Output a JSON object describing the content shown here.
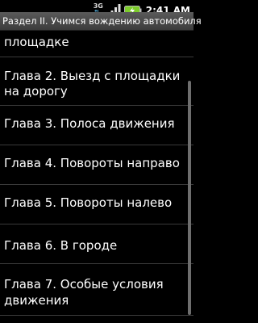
{
  "status_bar": {
    "network_label": "3G",
    "time": "2:41 AM"
  },
  "title": "Раздел II. Учимся вождению автомобиля",
  "items": [
    {
      "lines": [
        "площадке"
      ]
    },
    {
      "lines": [
        "Глава 2. Выезд с площадки",
        "на дорогу"
      ]
    },
    {
      "lines": [
        "Глава 3. Полоса движения"
      ]
    },
    {
      "lines": [
        "Глава 4. Повороты направо"
      ]
    },
    {
      "lines": [
        "Глава 5. Повороты налево"
      ]
    },
    {
      "lines": [
        "Глава 6. В городе"
      ]
    },
    {
      "lines": [
        "Глава 7. Особые условия",
        "движения"
      ]
    }
  ],
  "colors": {
    "background": "#000000",
    "titlebar": "#4a4a4a",
    "divider": "#3a3a3a",
    "text": "#ffffff",
    "battery": "#7ccc2a"
  }
}
